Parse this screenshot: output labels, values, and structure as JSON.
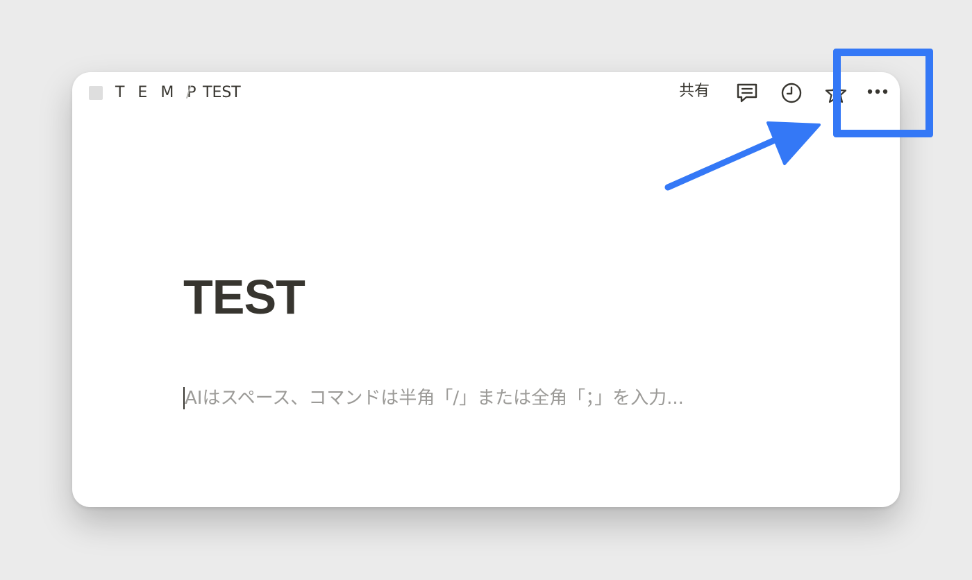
{
  "breadcrumb": {
    "parent": "T E M P",
    "separator": "/",
    "current": "TEST"
  },
  "toolbar": {
    "share_label": "共有",
    "icons": [
      "comment-icon",
      "clock-icon",
      "star-icon",
      "more-icon"
    ]
  },
  "page": {
    "title": "TEST",
    "placeholder": "AIはスペース、コマンドは半角「/」または全角「；」を入力..."
  },
  "annotation": {
    "color": "#3478f6",
    "shapes": [
      "highlight-box",
      "arrow"
    ]
  }
}
